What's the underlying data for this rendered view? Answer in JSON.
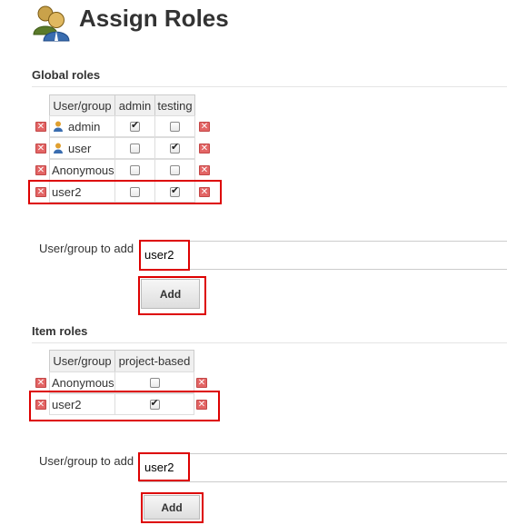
{
  "page": {
    "title": "Assign Roles"
  },
  "global_roles": {
    "heading": "Global roles",
    "columns": [
      "User/group",
      "admin",
      "testing"
    ],
    "rows": [
      {
        "name": "admin",
        "has_user_icon": true,
        "values": [
          true,
          false
        ]
      },
      {
        "name": "user",
        "has_user_icon": true,
        "values": [
          false,
          true
        ]
      },
      {
        "name": "Anonymous",
        "has_user_icon": false,
        "values": [
          false,
          false
        ]
      },
      {
        "name": "user2",
        "has_user_icon": false,
        "values": [
          false,
          true
        ]
      }
    ],
    "add_label": "User/group to add",
    "add_value": "user2",
    "add_button": "Add"
  },
  "item_roles": {
    "heading": "Item roles",
    "columns": [
      "User/group",
      "project-based"
    ],
    "rows": [
      {
        "name": "Anonymous",
        "values": [
          false
        ]
      },
      {
        "name": "user2",
        "values": [
          true
        ]
      }
    ],
    "add_label": "User/group to add",
    "add_value": "user2",
    "add_button": "Add"
  },
  "icons": {
    "header_icon": "users-icon",
    "delete_icon": "delete-icon",
    "user_icon": "user-icon",
    "checkmark": "✔",
    "delete_glyph": "✕"
  },
  "colors": {
    "highlight": "#dd0000",
    "delete": "#e36565"
  }
}
